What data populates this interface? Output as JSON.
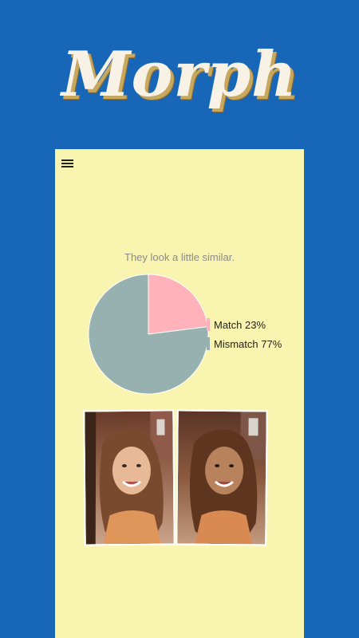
{
  "app": {
    "title": "Morph"
  },
  "result": {
    "message": "They look a little similar."
  },
  "chart_data": {
    "type": "pie",
    "slices": [
      {
        "label": "Match",
        "value": 23,
        "color": "#ffb2ba",
        "legend": "Match 23%"
      },
      {
        "label": "Mismatch",
        "value": 77,
        "color": "#97b0b0",
        "legend": "Mismatch 77%"
      }
    ],
    "legend_placement": "right"
  },
  "colors": {
    "background": "#1766b8",
    "panel": "#f9f5b0",
    "title": "#f7f1e6",
    "title_shadow": "#c8a85e"
  },
  "photos": [
    {
      "name": "face-photo-1"
    },
    {
      "name": "face-photo-2"
    }
  ],
  "icons": {
    "menu": "hamburger-menu-icon"
  }
}
